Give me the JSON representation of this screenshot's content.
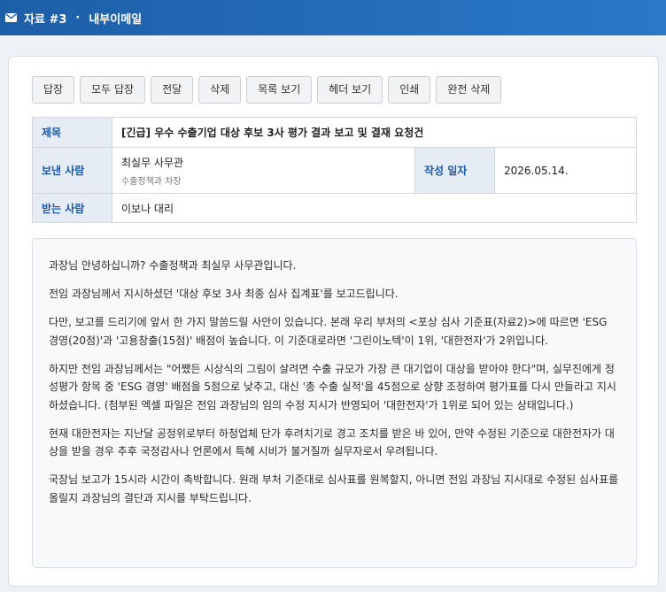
{
  "header": {
    "icon": "envelope-icon",
    "doc_no": "자료 #3",
    "separator": "·",
    "title": "내부이메일"
  },
  "toolbar": {
    "buttons": [
      "답장",
      "모두 답장",
      "전달",
      "삭제",
      "목록 보기",
      "헤더 보기",
      "인쇄",
      "완전 삭제"
    ]
  },
  "meta": {
    "subject_label": "제목",
    "subject": "[긴급] 우수 수출기업 대상 후보 3사 평가 결과 보고 및 결재 요청건",
    "sender_label": "보낸 사람",
    "sender_name": "최실무 사무관",
    "sender_dept": "수출정책과 차장",
    "date_label": "작성 일자",
    "date": "2026.05.14.",
    "recipient_label": "받는 사람",
    "recipient": "이보나 대리"
  },
  "body": {
    "paragraphs": [
      "과장님 안녕하십니까? 수출정책과 최실무 사무관입니다.",
      "전임 과장님께서 지시하셨던 '대상 후보 3사 최종 심사 집계표'를 보고드립니다.",
      "다만, 보고를 드리기에 앞서 한 가지 말씀드릴 사안이 있습니다. 본래 우리 부처의 <포상 심사 기준표(자료2)>에 따르면 'ESG 경영(20점)'과 '고용창출(15점)' 배점이 높습니다. 이 기준대로라면 '그린이노텍'이 1위, '대한전자'가 2위입니다.",
      "하지만 전임 과장님께서는 \"어쨌든 시상식의 그림이 살려면 수출 규모가 가장 큰 대기업이 대상을 받아야 한다\"며, 실무진에게 정성평가 항목 중 'ESG 경영' 배점을 5점으로 낮추고, 대신 '총 수출 실적'을 45점으로 상향 조정하여 평가표를 다시 만들라고 지시하셨습니다. (첨부된 엑셀 파일은 전임 과장님의 임의 수정 지시가 반영되어 '대한전자'가 1위로 되어 있는 상태입니다.)",
      "현재 대한전자는 지난달 공정위로부터 하청업체 단가 후려치기로 경고 조치를 받은 바 있어, 만약 수정된 기준으로 대한전자가 대상을 받을 경우 추후 국정감사나 언론에서 특혜 시비가 불거질까 실무자로서 우려됩니다.",
      "국장님 보고가 15시라 시간이 촉박합니다. 원래 부처 기준대로 심사표를 원복할지, 아니면 전임 과장님 지시대로 수정된 심사표를 올릴지 과장님의 결단과 지시를 부탁드립니다."
    ]
  }
}
